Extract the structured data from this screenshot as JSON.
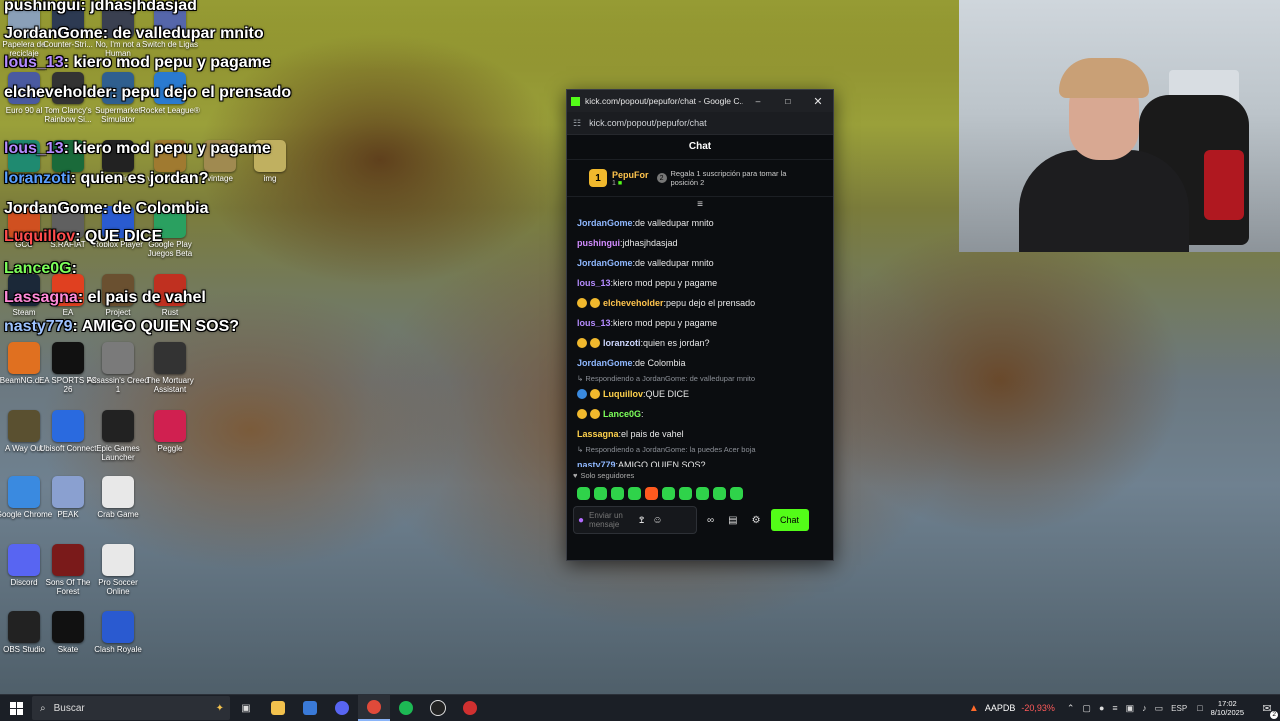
{
  "desktop": {
    "icons": [
      {
        "label": "Papelera de reciclaje",
        "color": "#8aa0b8"
      },
      {
        "label": "Counter-Stri...",
        "color": "#2d3a52"
      },
      {
        "label": "No, I'm not a Human",
        "color": "#3a4050"
      },
      {
        "label": "Switch de Ligas",
        "color": "#5566aa"
      },
      {
        "label": "Euro 90 al",
        "color": "#4a5aa0"
      },
      {
        "label": "Tom Clancy's Rainbow Si...",
        "color": "#333333"
      },
      {
        "label": "Supermarket Simulator",
        "color": "#2f5f8f"
      },
      {
        "label": "Rocket League®",
        "color": "#2a7ad0"
      },
      {
        "label": "Edge",
        "color": "#1f8a70"
      },
      {
        "label": "App",
        "color": "#1a6a3a"
      },
      {
        "label": "Studio",
        "color": "#222222"
      },
      {
        "label": "vintage Ga...",
        "color": "#a07a30"
      },
      {
        "label": "vintage",
        "color": "#a08a50"
      },
      {
        "label": "img",
        "color": "#c0b060"
      },
      {
        "label": "GCC",
        "color": "#d05020"
      },
      {
        "label": "S.RAFIAT",
        "color": "#606060"
      },
      {
        "label": "Roblox Player",
        "color": "#2a5bd0"
      },
      {
        "label": "Google Play Juegos Beta",
        "color": "#2aa060"
      },
      {
        "label": "Steam",
        "color": "#1b2838"
      },
      {
        "label": "EA",
        "color": "#e04020"
      },
      {
        "label": "Project",
        "color": "#6a5030"
      },
      {
        "label": "Rust",
        "color": "#c03020"
      },
      {
        "label": "BeamNG.dr...",
        "color": "#e07020"
      },
      {
        "label": "EA SPORTS FC 26",
        "color": "#111111"
      },
      {
        "label": "Assassin's Creed 1",
        "color": "#7a7a7a"
      },
      {
        "label": "The Mortuary Assistant",
        "color": "#333333"
      },
      {
        "label": "A Way Out",
        "color": "#5a5030"
      },
      {
        "label": "Ubisoft Connect",
        "color": "#2a6adf"
      },
      {
        "label": "Epic Games Launcher",
        "color": "#222222"
      },
      {
        "label": "Peggle",
        "color": "#d02050"
      },
      {
        "label": "Google Chrome",
        "color": "#3a8ae0"
      },
      {
        "label": "PEAK",
        "color": "#8aa0d0"
      },
      {
        "label": "Crab Game",
        "color": "#e8e8e8"
      },
      {
        "label": "Discord",
        "color": "#5865f2"
      },
      {
        "label": "Sons Of The Forest",
        "color": "#7a1a1a"
      },
      {
        "label": "Pro Soccer Online",
        "color": "#e8e8e8"
      },
      {
        "label": "OBS Studio",
        "color": "#222222"
      },
      {
        "label": "Skate",
        "color": "#111111"
      },
      {
        "label": "Clash Royale",
        "color": "#2a5ad0"
      }
    ]
  },
  "overlay_chat": [
    {
      "user": "pushingui",
      "text": "jdhasjhdasjad",
      "color": "#ffffff"
    },
    {
      "user": "JordanGome",
      "text": "de valledupar mnito",
      "color": "#ffffff"
    },
    {
      "user": "lous_13",
      "text": "kiero mod pepu y pagame",
      "color": "#b58cff"
    },
    {
      "user": "elcheveholder",
      "text": "pepu dejo el prensado",
      "color": "#ffffff"
    },
    {
      "user": "lous_13",
      "text": "kiero mod pepu y pagame",
      "color": "#b58cff"
    },
    {
      "user": "loranzoti",
      "text": "quien es jordan?",
      "color": "#5aa0ff"
    },
    {
      "user": "JordanGome",
      "text": "de Colombia",
      "color": "#ffffff"
    },
    {
      "user": "Luquillov",
      "text": "QUE DICE",
      "color": "#ff4d4d"
    },
    {
      "user": "Lance0G",
      "text": "",
      "color": "#7dff5a"
    },
    {
      "user": "Lassagna",
      "text": "el pais de vahel",
      "color": "#ff8ad8"
    },
    {
      "user": "nasty779",
      "text": "AMIGO QUIEN SOS?",
      "color": "#9ec3ff"
    }
  ],
  "browser": {
    "window_title": "kick.com/popout/pepufor/chat - Google C...",
    "url": "kick.com/popout/pepufor/chat"
  },
  "chat": {
    "header": "Chat",
    "pinned": {
      "rank": "1",
      "name": "PepuFor",
      "count": "1",
      "gift_count": "2",
      "gift_text": "Regala 1 suscripción para tomar la posición 2"
    },
    "messages": [
      {
        "reply": "",
        "user": "JordanGome",
        "text": "de valledupar mnito",
        "color": "#8fb8ff",
        "badges": []
      },
      {
        "reply": "",
        "user": "pushingui",
        "text": "jdhasjhdasjad",
        "color": "#d28cff",
        "badges": []
      },
      {
        "reply": "",
        "user": "JordanGome",
        "text": "de valledupar mnito",
        "color": "#8fb8ff",
        "badges": []
      },
      {
        "reply": "",
        "user": "lous_13",
        "text": "kiero mod pepu y pagame",
        "color": "#b58cff",
        "badges": []
      },
      {
        "reply": "",
        "user": "elcheveholder",
        "text": "pepu dejo el prensado",
        "color": "#ffc44d",
        "badges": [
          "#f0b82d",
          "#f0b82d"
        ]
      },
      {
        "reply": "",
        "user": "lous_13",
        "text": "kiero mod pepu y pagame",
        "color": "#b58cff",
        "badges": []
      },
      {
        "reply": "",
        "user": "loranzoti",
        "text": "quien es jordan?",
        "color": "#cfd8ff",
        "badges": [
          "#f0b82d",
          "#f0b82d"
        ]
      },
      {
        "reply": "",
        "user": "JordanGome",
        "text": "de Colombia",
        "color": "#8fb8ff",
        "badges": []
      },
      {
        "reply": "Respondiendo a JordanGome: de valledupar mnito",
        "user": "Luquillov",
        "text": "QUE DICE",
        "color": "#ffd24d",
        "badges": [
          "#3a8ae0",
          "#f0b82d"
        ]
      },
      {
        "reply": "",
        "user": "Lance0G",
        "text": "",
        "color": "#7dff5a",
        "badges": [
          "#f0b82d",
          "#f0b82d"
        ]
      },
      {
        "reply": "",
        "user": "Lassagna",
        "text": "el pais de vahel",
        "color": "#ffd24d",
        "badges": []
      },
      {
        "reply": "Respondiendo a JordanGome: la puedes Acer boja",
        "user": "nasty779",
        "text": "AMIGO QUIEN SOS?",
        "color": "#8fb8ff",
        "badges": []
      }
    ],
    "mode_label": "Solo seguidores",
    "input_placeholder": "Enviar un mensaje",
    "send_label": "Chat",
    "accent": "#53fc18"
  },
  "taskbar": {
    "search_placeholder": "Buscar",
    "ticker": "AAPDB",
    "ticker_change": "-20,93%",
    "language": "ESP",
    "time": "17:02",
    "date": "8/10/2025",
    "notification_count": "2"
  }
}
